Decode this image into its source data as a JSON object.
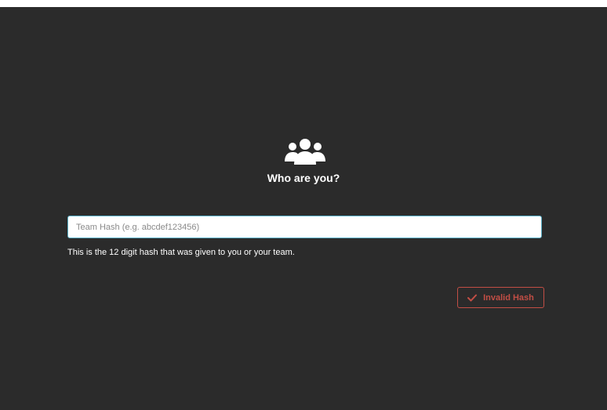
{
  "prompt": {
    "icon": "users-group-icon",
    "title": "Who are you?"
  },
  "form": {
    "placeholder": "Team Hash (e.g. abcdef123456)",
    "value": "",
    "help": "This is the 12 digit hash that was given to you or your team.",
    "status_button": {
      "icon": "check-icon",
      "label": "Invalid Hash",
      "color": "#c24e45"
    }
  },
  "colors": {
    "background": "#2b2b2b",
    "input_border": "#5ab0c8",
    "error": "#c24e45"
  }
}
